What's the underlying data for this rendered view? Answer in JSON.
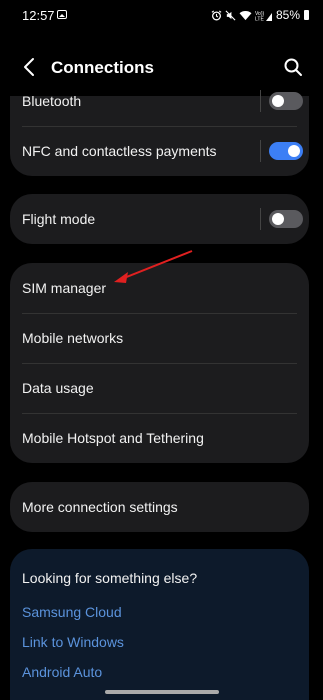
{
  "status_bar": {
    "time": "12:57",
    "signal_label": "Vo))\nLTE",
    "battery": "85%"
  },
  "header": {
    "title": "Connections"
  },
  "group1": {
    "items": [
      {
        "label": "Bluetooth",
        "toggle": "off"
      },
      {
        "label": "NFC and contactless payments",
        "toggle": "on"
      }
    ]
  },
  "group2": {
    "items": [
      {
        "label": "Flight mode",
        "toggle": "off"
      }
    ]
  },
  "group3": {
    "items": [
      {
        "label": "SIM manager"
      },
      {
        "label": "Mobile networks"
      },
      {
        "label": "Data usage"
      },
      {
        "label": "Mobile Hotspot and Tethering"
      }
    ]
  },
  "group4": {
    "items": [
      {
        "label": "More connection settings"
      }
    ]
  },
  "help": {
    "title": "Looking for something else?",
    "links": [
      "Samsung Cloud",
      "Link to Windows",
      "Android Auto"
    ]
  },
  "colors": {
    "accent": "#3c7ff5",
    "link": "#5b93dc",
    "card": "#1c1c1e",
    "annotation_arrow": "#e02020"
  },
  "icons": [
    "back-icon",
    "search-icon",
    "gallery-icon",
    "alarm-icon",
    "mute-icon",
    "wifi-icon",
    "signal-icon",
    "battery-icon"
  ]
}
